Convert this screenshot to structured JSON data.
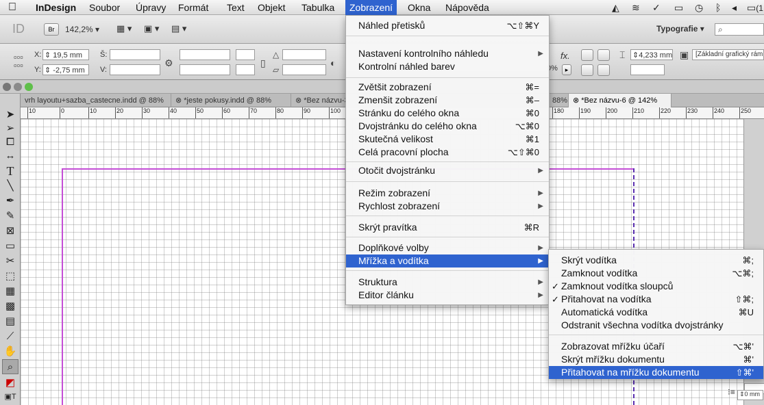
{
  "menubar": {
    "app": "InDesign",
    "items": [
      "Soubor",
      "Úpravy",
      "Formát",
      "Text",
      "Objekt",
      "Tabulka",
      "Zobrazení",
      "Okna",
      "Nápověda"
    ],
    "active": "Zobrazení",
    "tray_extra": "(1"
  },
  "control": {
    "zoom": "142,2%",
    "workspace": "Typografie",
    "x_label": "X:",
    "x_value": "19,5 mm",
    "y_label": "Y:",
    "y_value": "-2,75 mm",
    "w_label": "Š:",
    "h_label": "V:",
    "stroke_value": "4,233 mm",
    "frame_style": "[Základní grafický rám",
    "pct_fragment": "0%",
    "spacing_value": "0 mm"
  },
  "tabs": [
    {
      "label": "vrh layoutu+sazba_castecne.indd @ 88%"
    },
    {
      "label": "*jeste pokusy.indd @ 88%"
    },
    {
      "label": "*Bez názvu-3"
    },
    {
      "label": "88%"
    },
    {
      "label": "*Bez názvu-6 @ 142%"
    }
  ],
  "ruler": [
    "10",
    "0",
    "10",
    "20",
    "30",
    "40",
    "50",
    "60",
    "70",
    "80",
    "90",
    "100",
    "180",
    "190",
    "200",
    "210",
    "220",
    "230",
    "240",
    "250"
  ],
  "view_menu": {
    "items": [
      {
        "label": "Náhled přetisků",
        "shortcut": "⌥⇧⌘Y"
      },
      {
        "label": "Nastavení kontrolního náhledu",
        "submenu": true
      },
      {
        "label": "Kontrolní náhled barev"
      },
      {
        "label": "Zvětšit zobrazení",
        "shortcut": "⌘="
      },
      {
        "label": "Zmenšit zobrazení",
        "shortcut": "⌘–"
      },
      {
        "label": "Stránku do celého okna",
        "shortcut": "⌘0"
      },
      {
        "label": "Dvojstránku do celého okna",
        "shortcut": "⌥⌘0"
      },
      {
        "label": "Skutečná velikost",
        "shortcut": "⌘1"
      },
      {
        "label": "Celá pracovní plocha",
        "shortcut": "⌥⇧⌘0"
      },
      {
        "label": "Otočit dvojstránku",
        "submenu": true
      },
      {
        "label": "Režim zobrazení",
        "submenu": true
      },
      {
        "label": "Rychlost zobrazení",
        "submenu": true
      },
      {
        "label": "Skrýt pravítka",
        "shortcut": "⌘R"
      },
      {
        "label": "Doplňkové volby",
        "submenu": true
      },
      {
        "label": "Mřížka a vodítka",
        "submenu": true,
        "highlighted": true
      },
      {
        "label": "Struktura",
        "submenu": true
      },
      {
        "label": "Editor článku",
        "submenu": true
      }
    ]
  },
  "grid_submenu": {
    "items": [
      {
        "label": "Skrýt vodítka",
        "shortcut": "⌘;"
      },
      {
        "label": "Zamknout vodítka",
        "shortcut": "⌥⌘;"
      },
      {
        "label": "Zamknout vodítka sloupců",
        "checked": true
      },
      {
        "label": "Přitahovat na vodítka",
        "shortcut": "⇧⌘;",
        "checked": true
      },
      {
        "label": "Automatická vodítka",
        "shortcut": "⌘U"
      },
      {
        "label": "Odstranit všechna vodítka dvojstránky"
      },
      {
        "label": "Zobrazovat mřížku účaří",
        "shortcut": "⌥⌘'"
      },
      {
        "label": "Skrýt mřížku dokumentu",
        "shortcut": "⌘'"
      },
      {
        "label": "Přitahovat na mřížku dokumentu",
        "shortcut": "⇧⌘'",
        "highlighted": true
      }
    ]
  },
  "colors": {
    "highlight": "#2f63cf",
    "margin_guide": "#c44ed6",
    "column_guide": "#5a2fb0"
  },
  "tools": [
    "selection-tool",
    "direct-selection-tool",
    "page-tool",
    "gap-tool",
    "type-tool",
    "line-tool",
    "pen-tool",
    "pencil-tool",
    "rectangle-frame-tool",
    "rectangle-tool",
    "scissors-tool",
    "free-transform-tool",
    "gradient-swatch-tool",
    "gradient-feather-tool",
    "note-tool",
    "eyedropper-tool",
    "hand-tool",
    "zoom-tool",
    "fill-stroke-swatch",
    "formatting-affects-text"
  ]
}
